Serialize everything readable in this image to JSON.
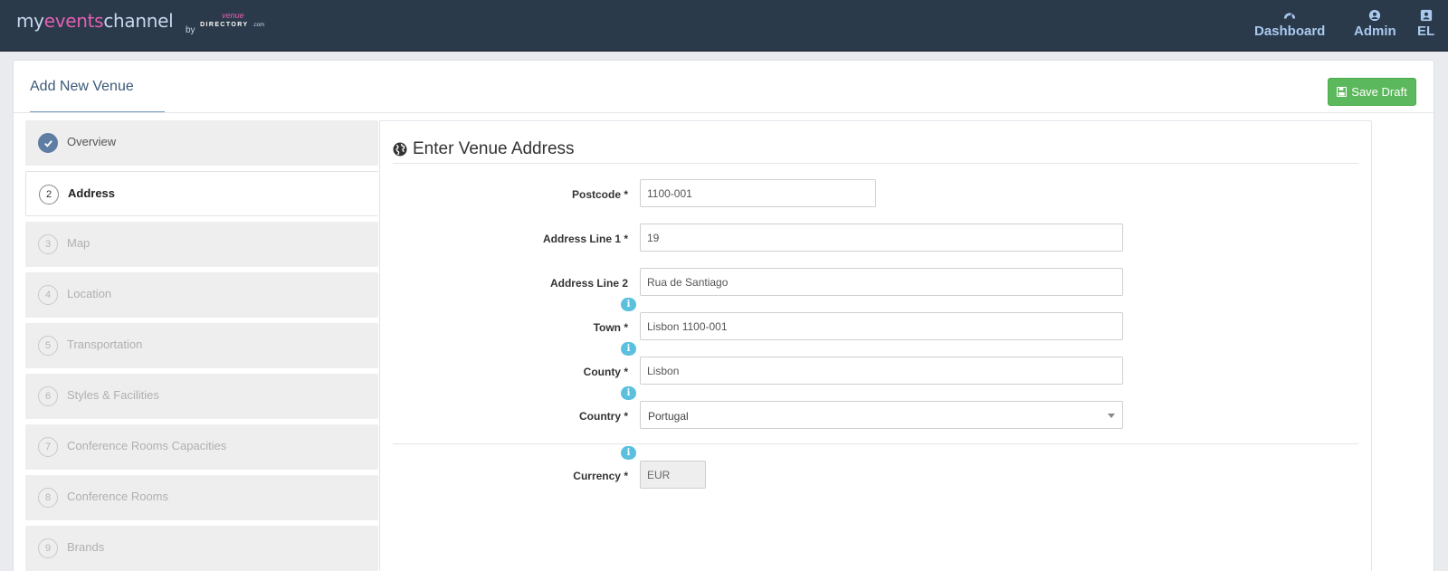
{
  "header": {
    "logo": {
      "my": "my",
      "events": "events",
      "channel": "channel",
      "by": "by",
      "venue": "venue",
      "directory": "DIRECTORY",
      "com": ".com"
    },
    "nav": [
      {
        "label": "Dashboard",
        "icon": "dashboard-icon"
      },
      {
        "label": "Admin",
        "icon": "user-circle-icon"
      },
      {
        "label": "EL",
        "icon": "user-square-icon"
      }
    ]
  },
  "page": {
    "title": "Add New Venue",
    "save_draft_label": "Save Draft"
  },
  "steps": [
    {
      "num": "",
      "label": "Overview",
      "state": "done"
    },
    {
      "num": "2",
      "label": "Address",
      "state": "active"
    },
    {
      "num": "3",
      "label": "Map",
      "state": "pending"
    },
    {
      "num": "4",
      "label": "Location",
      "state": "pending"
    },
    {
      "num": "5",
      "label": "Transportation",
      "state": "pending"
    },
    {
      "num": "6",
      "label": "Styles & Facilities",
      "state": "pending"
    },
    {
      "num": "7",
      "label": "Conference Rooms Capacities",
      "state": "pending"
    },
    {
      "num": "8",
      "label": "Conference Rooms",
      "state": "pending"
    },
    {
      "num": "9",
      "label": "Brands",
      "state": "pending"
    }
  ],
  "form": {
    "heading": "Enter Venue Address",
    "info_symbol": "i",
    "fields": {
      "postcode": {
        "label": "Postcode *",
        "value": "1100-001"
      },
      "address1": {
        "label": "Address Line 1 *",
        "value": "19"
      },
      "address2": {
        "label": "Address Line 2",
        "value": "Rua de Santiago"
      },
      "town": {
        "label": "Town *",
        "value": "Lisbon 1100-001"
      },
      "county": {
        "label": "County *",
        "value": "Lisbon"
      },
      "country": {
        "label": "Country *",
        "value": "Portugal"
      },
      "currency": {
        "label": "Currency *",
        "value": "EUR"
      }
    }
  },
  "colors": {
    "topbar": "#2b3a4a",
    "nav_text": "#a9c9ee",
    "brand_pink": "#e45fb3",
    "save_green": "#5cb85c",
    "info_blue": "#5bc0de",
    "step_done": "#5e7da3"
  }
}
